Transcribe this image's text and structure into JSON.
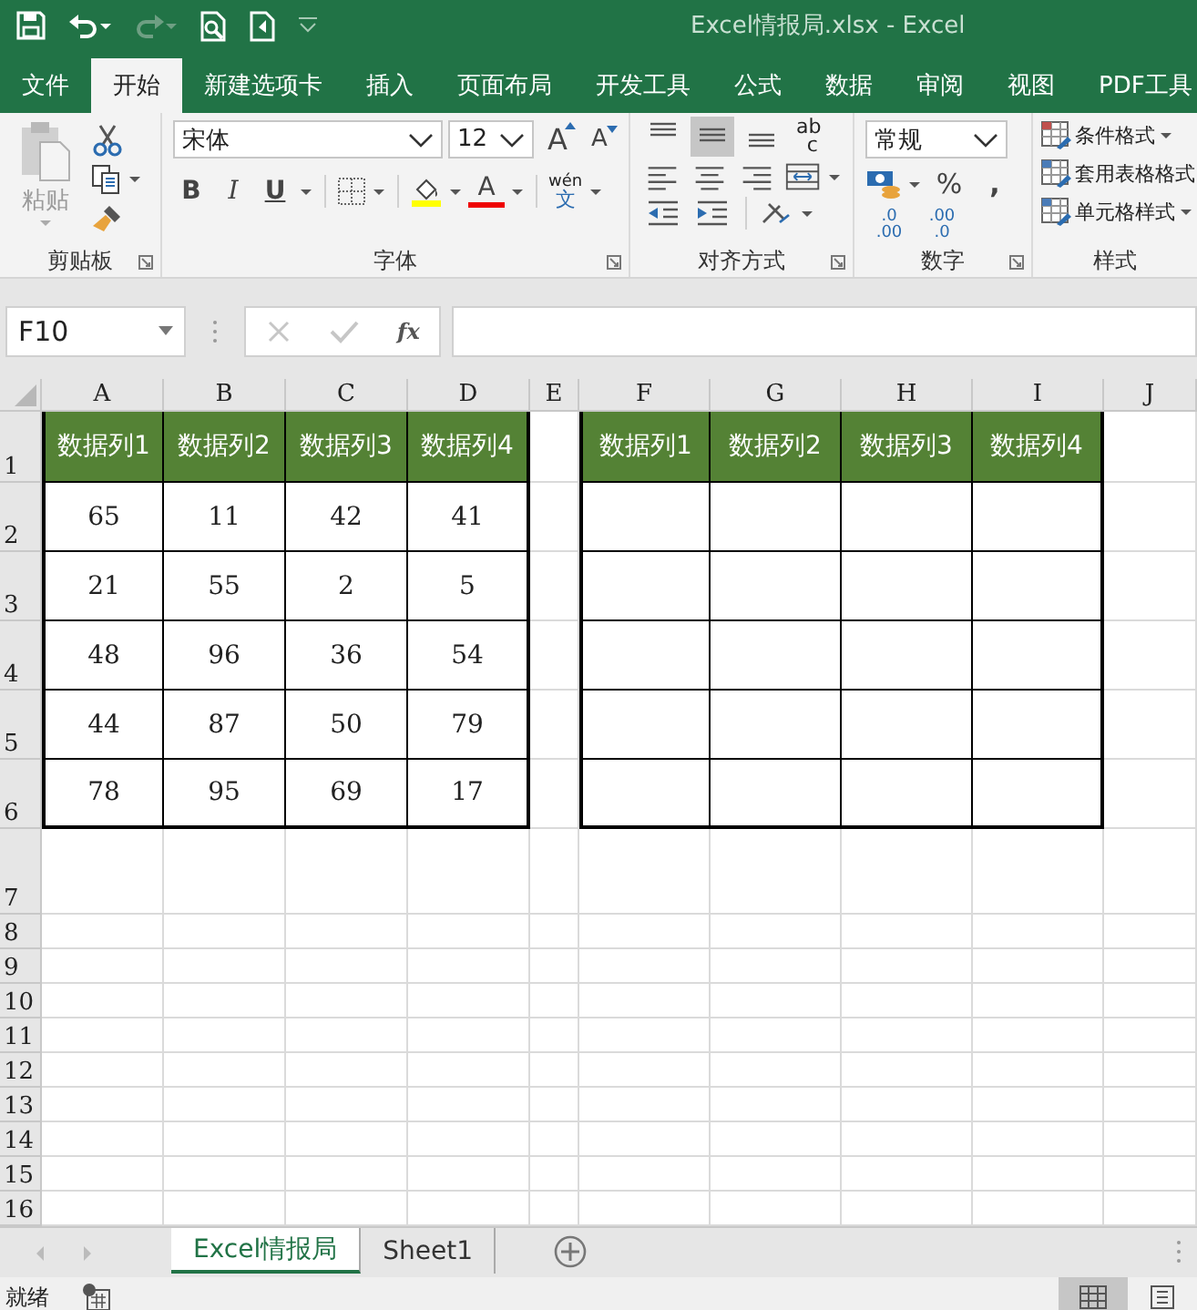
{
  "title_bar": {
    "title": "Excel情报局.xlsx  -  Excel"
  },
  "quick_access": [
    {
      "kind": "save",
      "disabled": false
    },
    {
      "kind": "undo",
      "disabled": false
    },
    {
      "kind": "redo",
      "disabled": true
    },
    {
      "kind": "print-preview",
      "disabled": false
    },
    {
      "kind": "touch-mode",
      "disabled": false
    }
  ],
  "tabs": [
    {
      "label": "文件",
      "selected": false
    },
    {
      "label": "开始",
      "selected": true
    },
    {
      "label": "新建选项卡",
      "selected": false
    },
    {
      "label": "插入",
      "selected": false
    },
    {
      "label": "页面布局",
      "selected": false
    },
    {
      "label": "开发工具",
      "selected": false
    },
    {
      "label": "公式",
      "selected": false
    },
    {
      "label": "数据",
      "selected": false
    },
    {
      "label": "审阅",
      "selected": false
    },
    {
      "label": "视图",
      "selected": false
    },
    {
      "label": "PDF工具",
      "selected": false
    }
  ],
  "ribbon": {
    "clipboard": {
      "label": "剪贴板",
      "paste_label": "粘贴",
      "paste_disabled": true
    },
    "font": {
      "label": "字体",
      "font_name": "宋体",
      "font_size": "12",
      "grow": "A",
      "shrink": "A",
      "bold": "B",
      "italic": "I",
      "underline": "U",
      "font_color": "A",
      "phonetic_top": "wén",
      "phonetic_bottom": "文"
    },
    "alignment": {
      "label": "对齐方式",
      "vertical": [
        {
          "kind": "top",
          "selected": false
        },
        {
          "kind": "middle",
          "selected": true
        },
        {
          "kind": "bottom",
          "selected": false
        }
      ],
      "wrap_top": "ab",
      "wrap_bottom": "c"
    },
    "number": {
      "label": "数字",
      "format": "常规",
      "percent": "%",
      "comma": ",",
      "inc_top": ".0",
      "inc_bottom": ".00",
      "dec_top": ".00",
      "dec_bottom": ".0"
    },
    "styles": {
      "label": "样式",
      "items": [
        "条件格式",
        "套用表格格式",
        "单元格样式"
      ]
    }
  },
  "formula_bar": {
    "name_box": "F10",
    "fx": "fx",
    "cancel_disabled": true,
    "enter_disabled": true
  },
  "sheet": {
    "columns": [
      "A",
      "B",
      "C",
      "D",
      "E",
      "F",
      "G",
      "H",
      "I",
      "J"
    ],
    "rows": [
      "1",
      "2",
      "3",
      "4",
      "5",
      "6",
      "7",
      "8",
      "9",
      "10",
      "11",
      "12",
      "13",
      "14",
      "15",
      "16"
    ],
    "table_1": {
      "headers": [
        "数据列1",
        "数据列2",
        "数据列3",
        "数据列4"
      ],
      "rows": [
        [
          "65",
          "11",
          "42",
          "41"
        ],
        [
          "21",
          "55",
          "2",
          "5"
        ],
        [
          "48",
          "96",
          "36",
          "54"
        ],
        [
          "44",
          "87",
          "50",
          "79"
        ],
        [
          "78",
          "95",
          "69",
          "17"
        ]
      ]
    },
    "table_2": {
      "headers": [
        "数据列1",
        "数据列2",
        "数据列3",
        "数据列4"
      ]
    }
  },
  "sheet_tabs": [
    {
      "label": "Excel情报局",
      "selected": true
    },
    {
      "label": "Sheet1",
      "selected": false
    }
  ],
  "status_bar": {
    "text": "就绪"
  }
}
